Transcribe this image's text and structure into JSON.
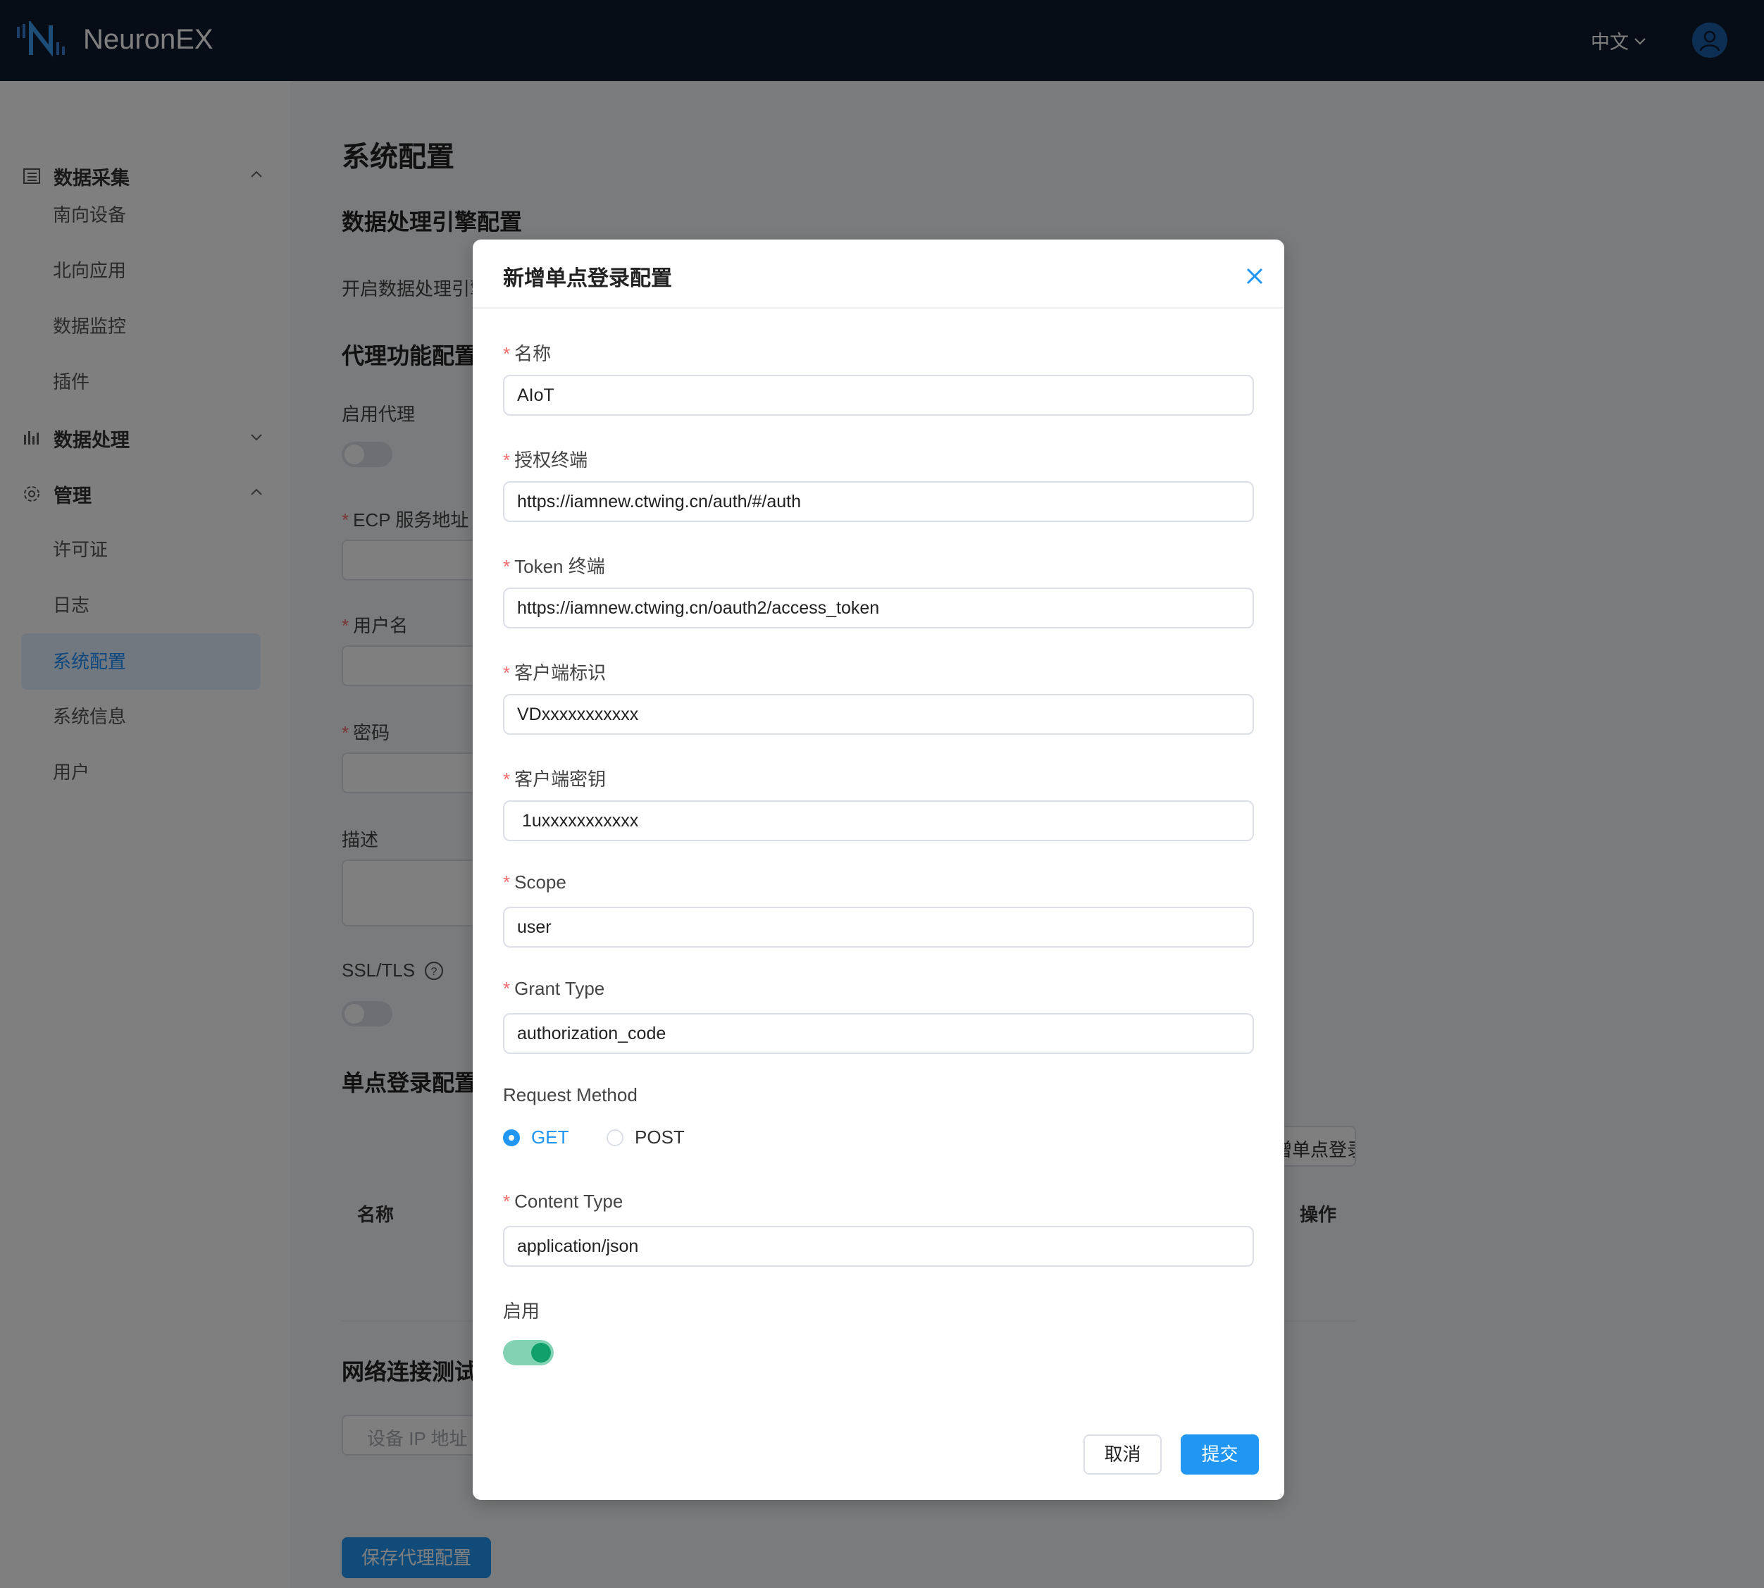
{
  "header": {
    "brand": "NeuronEX",
    "language": "中文"
  },
  "sidebar": {
    "groups": [
      {
        "label": "数据采集",
        "items": [
          "南向设备",
          "北向应用",
          "数据监控",
          "插件"
        ]
      },
      {
        "label": "数据处理",
        "items": []
      },
      {
        "label": "管理",
        "items": [
          "许可证",
          "日志",
          "系统配置",
          "系统信息",
          "用户"
        ]
      }
    ],
    "active": "系统配置"
  },
  "page": {
    "title": "系统配置",
    "engine_section": "数据处理引擎配置",
    "engine_enable_label": "开启数据处理引擎",
    "proxy_section": "代理功能配置",
    "proxy_enable_label": "启用代理",
    "ecp_label": "ECP 服务地址",
    "username_label": "用户名",
    "password_label": "密码",
    "desc_label": "描述",
    "ssl_label": "SSL/TLS",
    "sso_section": "单点登录配置",
    "add_sso_button": "新增单点登录配置",
    "table_col_name": "名称",
    "table_col_action": "操作",
    "network_section": "网络连接测试",
    "ip_placeholder": "设备 IP 地址",
    "save_proxy_button": "保存代理配置"
  },
  "dialog": {
    "title": "新增单点登录配置",
    "fields": {
      "name": {
        "label": "名称",
        "value": "AIoT"
      },
      "auth_endpoint": {
        "label": "授权终端",
        "value": "https://iamnew.ctwing.cn/auth/#/auth"
      },
      "token_endpoint": {
        "label": "Token 终端",
        "value": "https://iamnew.ctwing.cn/oauth2/access_token"
      },
      "client_id": {
        "label": "客户端标识",
        "value": "VDxxxxxxxxxxx"
      },
      "client_secret": {
        "label": "客户端密钥",
        "value": " 1uxxxxxxxxxxx"
      },
      "scope": {
        "label": "Scope",
        "value": "user"
      },
      "grant_type": {
        "label": "Grant Type",
        "value": "authorization_code"
      },
      "request_method": {
        "label": "Request Method",
        "options": [
          "GET",
          "POST"
        ],
        "selected": "GET"
      },
      "content_type": {
        "label": "Content Type",
        "value": "application/json"
      },
      "enabled": {
        "label": "启用",
        "value": true
      }
    },
    "cancel": "取消",
    "submit": "提交"
  },
  "colors": {
    "header_bg": "#0f1a2f",
    "primary": "#2196f3",
    "toggle_on": "#12a06a",
    "required": "#f56c6c"
  }
}
